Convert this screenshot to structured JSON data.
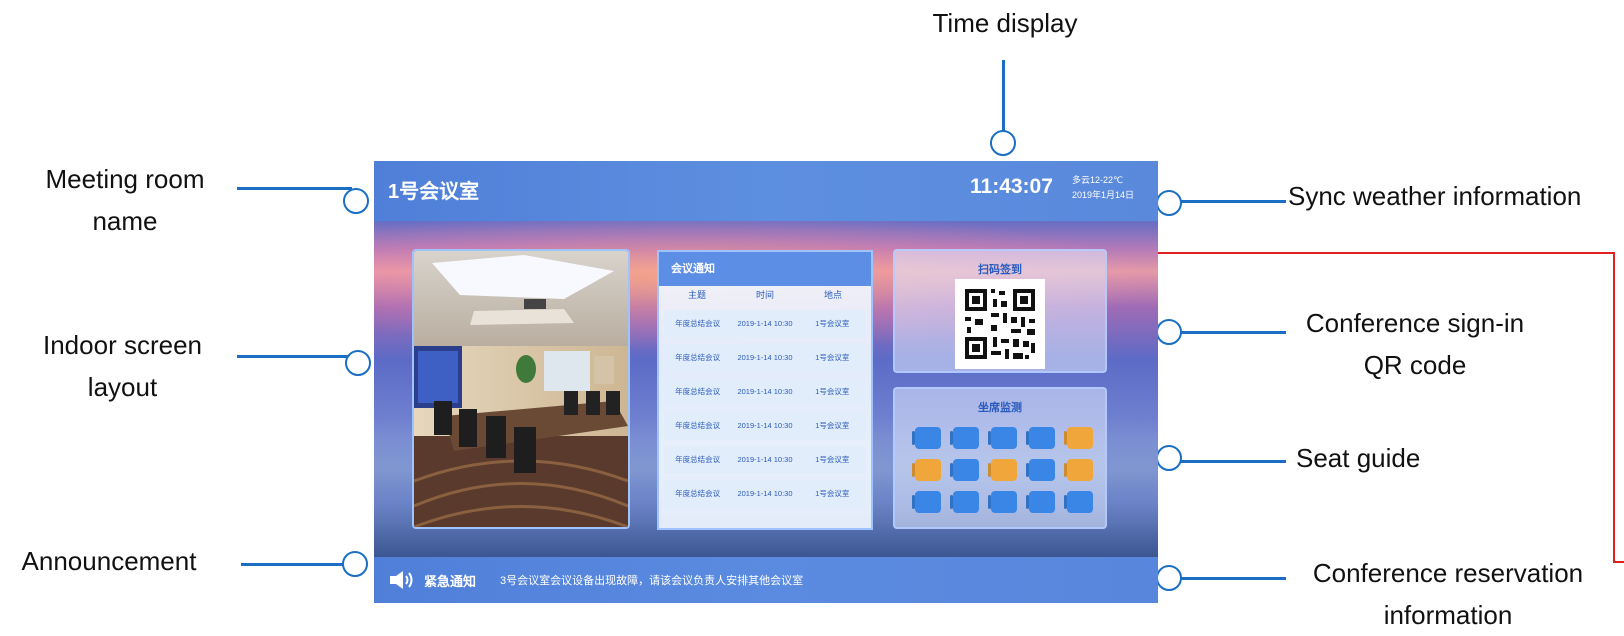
{
  "callouts": {
    "time_display": "Time display",
    "meeting_room_name": [
      "Meeting room",
      "name"
    ],
    "indoor_screen_layout": [
      "Indoor screen",
      "layout"
    ],
    "announcement": "Announcement",
    "sync_weather": "Sync weather information",
    "sign_in_qr": [
      "Conference sign-in",
      "QR code"
    ],
    "seat_guide": "Seat guide",
    "reservation_info": [
      "Conference reservation",
      "information"
    ]
  },
  "screen": {
    "room_name": "1号会议室",
    "time": "11:43:07",
    "weather": "多云12-22℃",
    "date": "2019年1月14日",
    "notice_board": {
      "title": "会议通知",
      "columns": [
        "主题",
        "时间",
        "地点"
      ],
      "rows": [
        [
          "年度总结会议",
          "2019-1-14 10:30",
          "1号会议室"
        ],
        [
          "年度总结会议",
          "2019-1-14 10:30",
          "1号会议室"
        ],
        [
          "年度总结会议",
          "2019-1-14 10:30",
          "1号会议室"
        ],
        [
          "年度总结会议",
          "2019-1-14 10:30",
          "1号会议室"
        ],
        [
          "年度总结会议",
          "2019-1-14 10:30",
          "1号会议室"
        ],
        [
          "年度总结会议",
          "2019-1-14 10:30",
          "1号会议室"
        ]
      ]
    },
    "sign_in": {
      "title": "扫码签到"
    },
    "seat_monitor": {
      "title": "坐席监测",
      "seat_status": [
        [
          "available",
          "available",
          "available",
          "available",
          "occupied"
        ],
        [
          "occupied",
          "available",
          "occupied",
          "available",
          "occupied"
        ],
        [
          "available",
          "available",
          "available",
          "available",
          "available"
        ]
      ],
      "colors": {
        "available": "#3a86e6",
        "occupied": "#f0a63a"
      }
    },
    "announcement": {
      "icon": "speaker-icon",
      "label": "紧急通知",
      "text": "3号会议室会议设备出现故障，请该会议负责人安排其他会议室"
    }
  },
  "colors": {
    "callout_line": "#1a6fc4",
    "bracket_line": "#e02020"
  }
}
